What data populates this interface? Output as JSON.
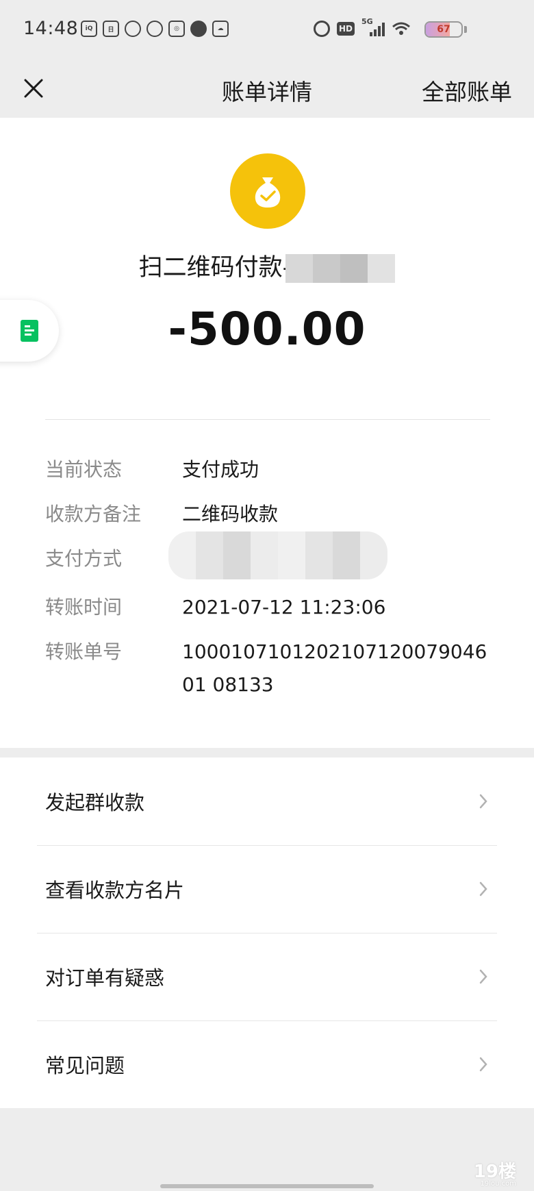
{
  "status_bar": {
    "time": "14:48",
    "battery_level": "67",
    "battery_fraction": 0.67,
    "network": "5G",
    "hd_label": "HD"
  },
  "nav": {
    "title": "账单详情",
    "right_link": "全部账单"
  },
  "bill": {
    "merchant_name": "扫二维码付款-",
    "amount": "-500.00",
    "details": [
      {
        "label": "当前状态",
        "value": "支付成功"
      },
      {
        "label": "收款方备注",
        "value": "二维码收款"
      },
      {
        "label": "支付方式",
        "value": ""
      },
      {
        "label": "转账时间",
        "value": "2021-07-12 11:23:06"
      },
      {
        "label": "转账单号",
        "value": "100010710120210712007904601 08133"
      }
    ]
  },
  "actions": [
    {
      "label": "发起群收款"
    },
    {
      "label": "查看收款方名片"
    },
    {
      "label": "对订单有疑惑"
    },
    {
      "label": "常见问题"
    }
  ],
  "watermark": {
    "text": "19楼",
    "sub": "19lou.com"
  },
  "colors": {
    "accent_yellow": "#f5c20b",
    "accent_green": "#07c160",
    "background": "#ededed"
  }
}
